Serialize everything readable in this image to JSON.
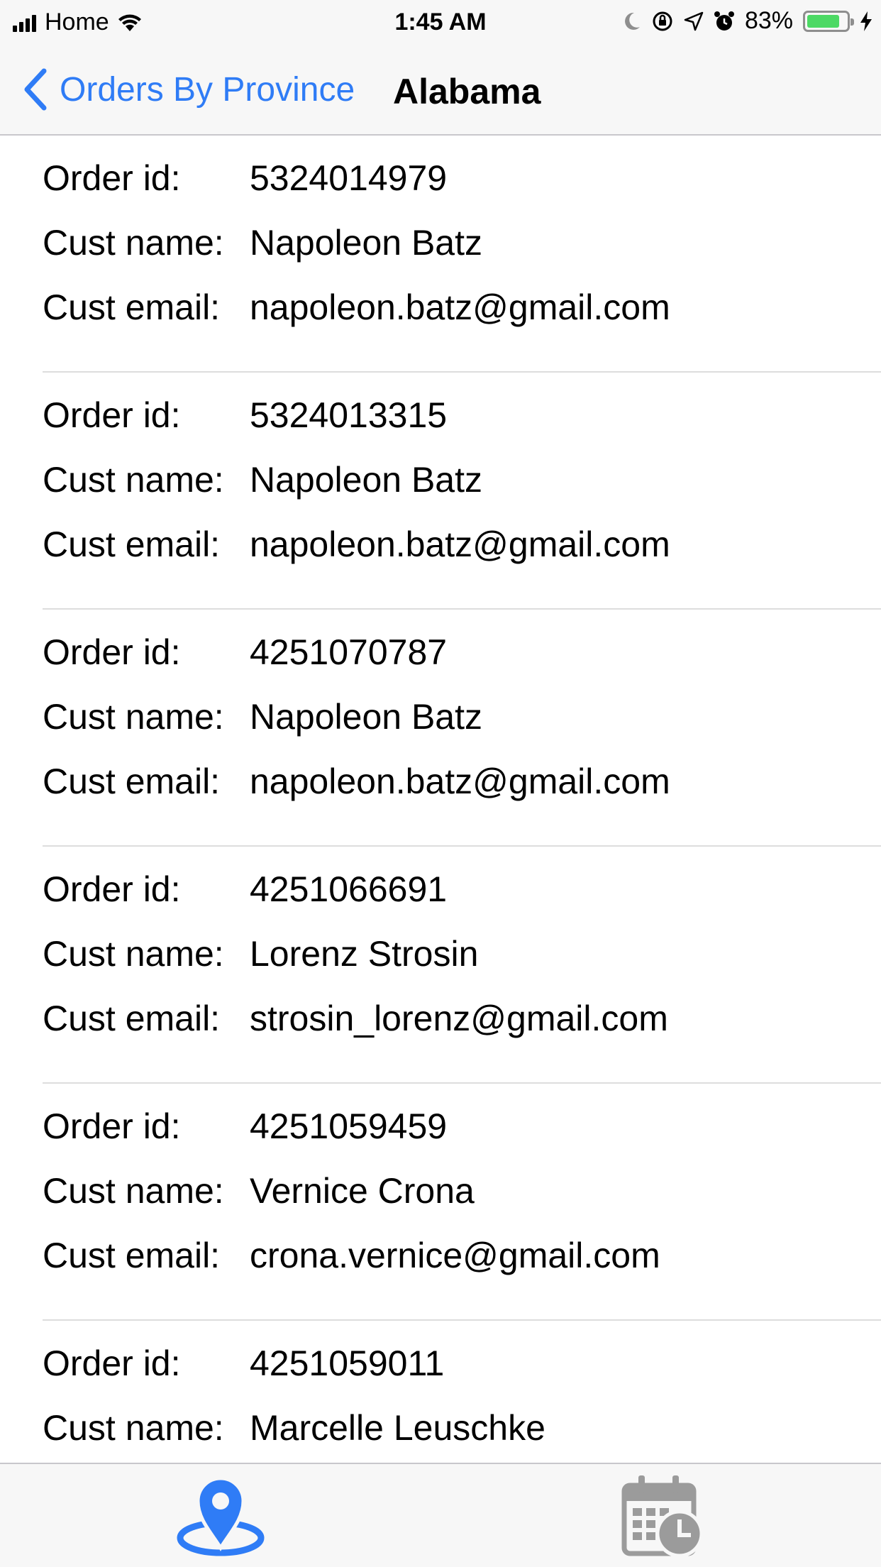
{
  "status_bar": {
    "carrier": "Home",
    "time": "1:45 AM",
    "battery_percent": "83%",
    "battery_level": 0.83,
    "battery_color": "#4cd964"
  },
  "nav": {
    "back_label": "Orders By Province",
    "title": "Alabama",
    "accent_color": "#2f7cf6"
  },
  "labels": {
    "order_id": "Order id:",
    "cust_name": "Cust name:",
    "cust_email": "Cust email:"
  },
  "orders": [
    {
      "order_id": "5324014979",
      "cust_name": "Napoleon Batz",
      "cust_email": "napoleon.batz@gmail.com"
    },
    {
      "order_id": "5324013315",
      "cust_name": "Napoleon Batz",
      "cust_email": "napoleon.batz@gmail.com"
    },
    {
      "order_id": "4251070787",
      "cust_name": "Napoleon Batz",
      "cust_email": "napoleon.batz@gmail.com"
    },
    {
      "order_id": "4251066691",
      "cust_name": "Lorenz Strosin",
      "cust_email": "strosin_lorenz@gmail.com"
    },
    {
      "order_id": "4251059459",
      "cust_name": "Vernice Crona",
      "cust_email": "crona.vernice@gmail.com"
    },
    {
      "order_id": "4251059011",
      "cust_name": "Marcelle Leuschke",
      "cust_email": ""
    }
  ],
  "tabs": [
    {
      "icon": "map-pin-icon",
      "selected": true,
      "color": "#2f7cf6"
    },
    {
      "icon": "calendar-clock-icon",
      "selected": false,
      "color": "#9b9b9b"
    }
  ]
}
